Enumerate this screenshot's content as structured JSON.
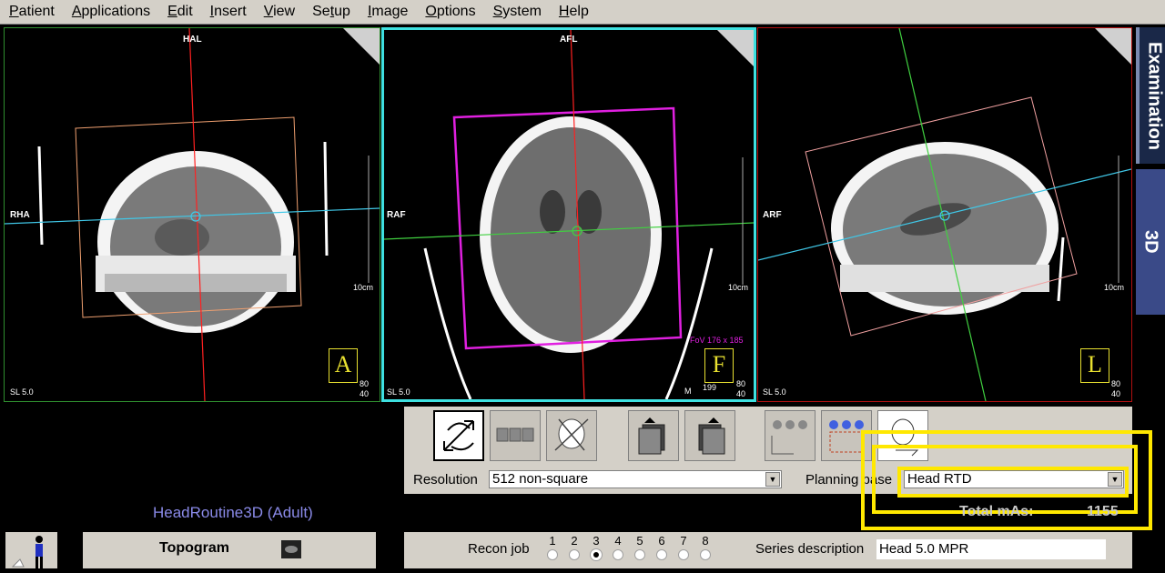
{
  "menu": [
    "Patient",
    "Applications",
    "Edit",
    "Insert",
    "View",
    "Setup",
    "Image",
    "Options",
    "System",
    "Help"
  ],
  "menu_underline": [
    "P",
    "A",
    "E",
    "I",
    "V",
    "t",
    "I",
    "O",
    "S",
    "H"
  ],
  "viewports": [
    {
      "top": "HAL",
      "left": "RHA",
      "sl": "SL 5.0",
      "scale": "10cm",
      "orient": "A",
      "w": "80",
      "c": "40"
    },
    {
      "top": "AFL",
      "left": "RAF",
      "sl": "SL 5.0",
      "scale": "10cm",
      "orient": "F",
      "w": "80",
      "c": "40",
      "fov": "FoV 176 x 185",
      "m": "M",
      "num": "199"
    },
    {
      "top": "",
      "left": "ARF",
      "sl": "SL 5.0",
      "scale": "10cm",
      "orient": "L",
      "w": "80",
      "c": "40"
    }
  ],
  "tabs": {
    "examination": "Examination",
    "three_d": "3D"
  },
  "panel": {
    "resolution_label": "Resolution",
    "resolution_value": "512 non-square",
    "planning_label": "Planning base",
    "planning_value": "Head  RTD"
  },
  "protocol": "HeadRoutine3D (Adult)",
  "total_mas_label": "Total mAs:",
  "total_mas_value": "1155",
  "topogram": "Topogram",
  "recon": {
    "label": "Recon job",
    "jobs": [
      "1",
      "2",
      "3",
      "4",
      "5",
      "6",
      "7",
      "8"
    ],
    "selected": 3
  },
  "series": {
    "label": "Series description",
    "value": "Head  5.0  MPR"
  },
  "colors": {
    "accent_cyan": "#3ee0e0",
    "highlight": "#ffe800",
    "tab_active": "#1a2848",
    "tab_inactive": "#3a4a88"
  }
}
